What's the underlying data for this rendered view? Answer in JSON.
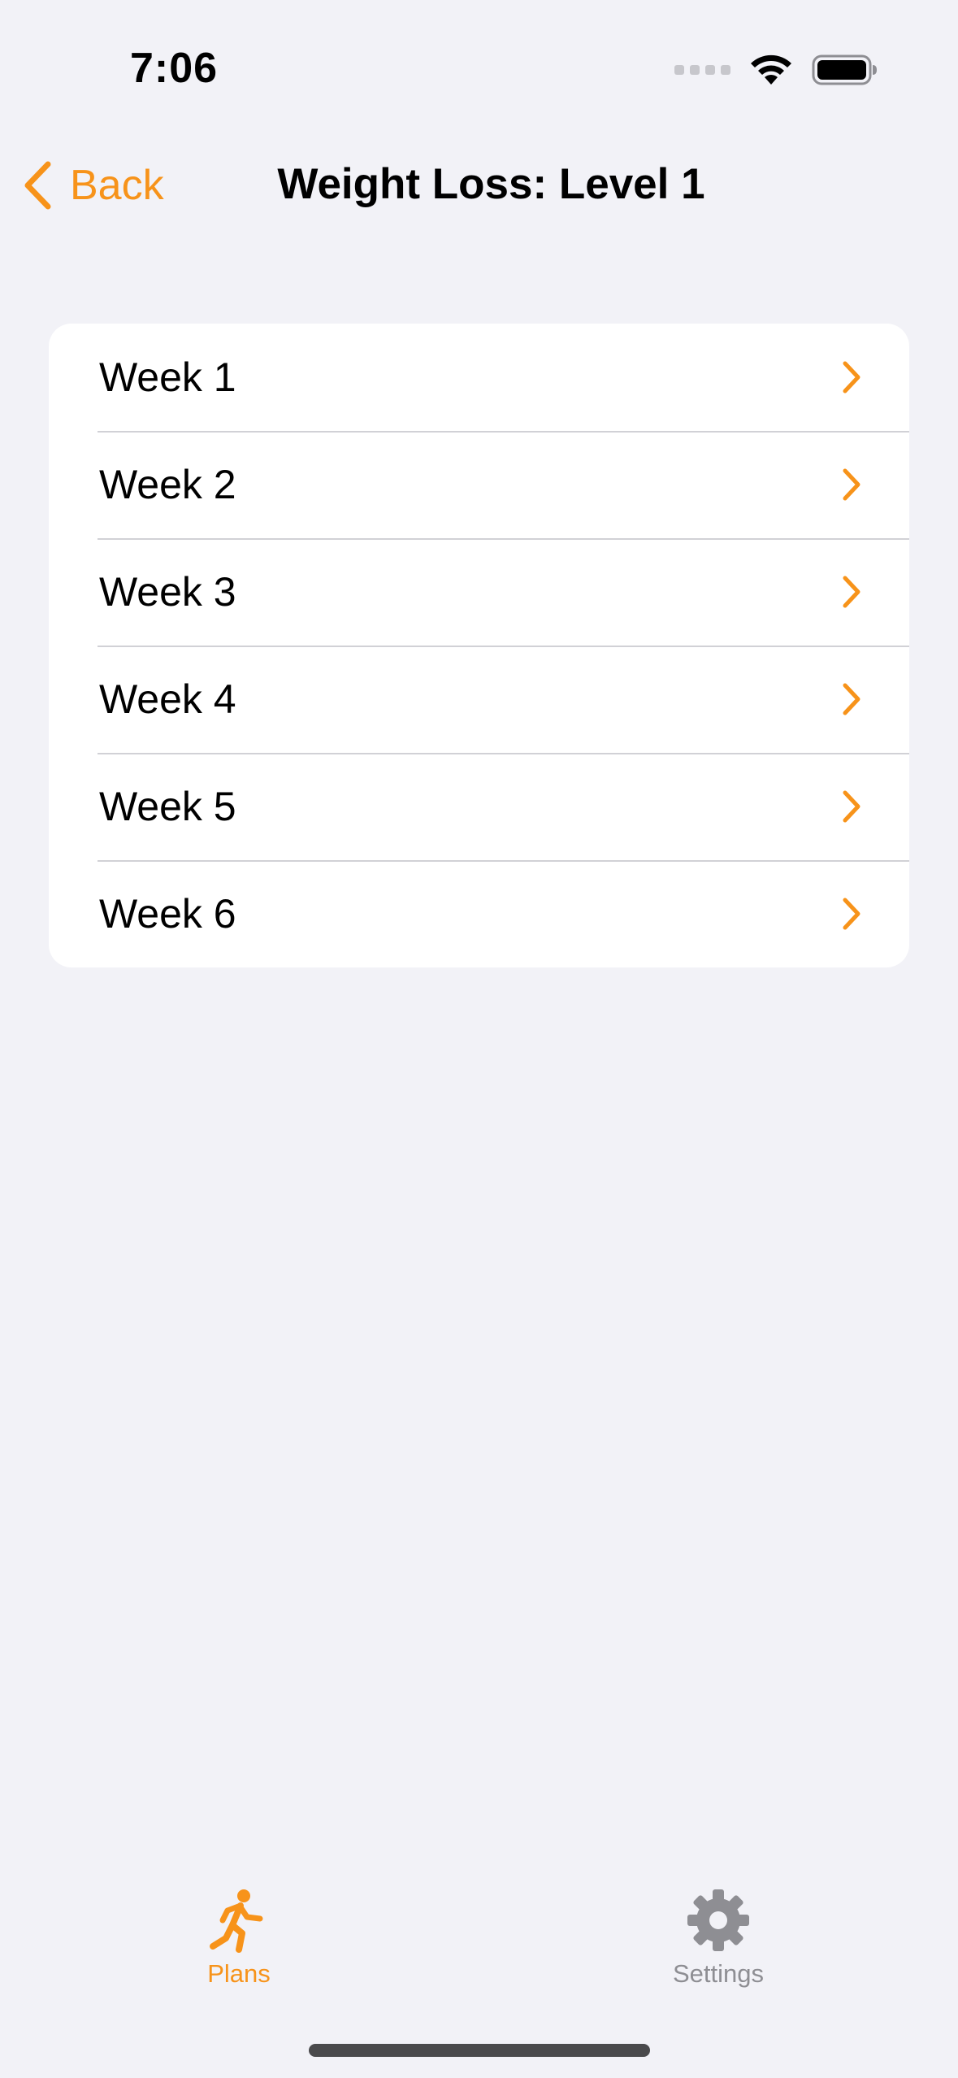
{
  "status_bar": {
    "time": "7:06",
    "icons": [
      "cellular-signal-icon",
      "wifi-icon",
      "battery-icon"
    ]
  },
  "nav": {
    "back_label": "Back",
    "title": "Weight Loss: Level 1"
  },
  "weeks": [
    {
      "label": "Week 1"
    },
    {
      "label": "Week 2"
    },
    {
      "label": "Week 3"
    },
    {
      "label": "Week 4"
    },
    {
      "label": "Week 5"
    },
    {
      "label": "Week 6"
    }
  ],
  "tab_bar": {
    "tabs": [
      {
        "label": "Plans",
        "icon": "running-figure-icon",
        "selected": true
      },
      {
        "label": "Settings",
        "icon": "gear-icon",
        "selected": false
      }
    ]
  },
  "colors": {
    "accent": "#f7931a",
    "background": "#f2f2f7",
    "card": "#ffffff",
    "inactive": "#8e8e93"
  }
}
